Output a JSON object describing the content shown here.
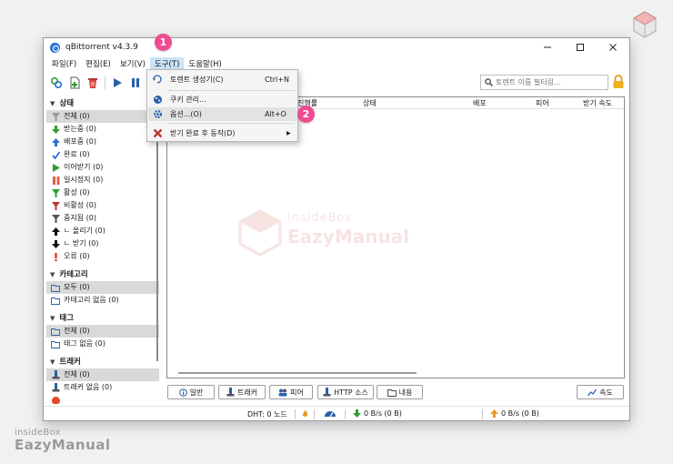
{
  "window": {
    "title": "qBittorrent v4.3.9"
  },
  "menubar": [
    "파일(F)",
    "편집(E)",
    "보기(V)",
    "도구(T)",
    "도움말(H)"
  ],
  "toolbar": {
    "search_placeholder": "토렌트 이름 필터링..."
  },
  "dropdown": {
    "items": [
      {
        "label": "토렌트 생성기(C)",
        "shortcut": "Ctrl+N",
        "icon": "torrent-creator-icon"
      },
      {
        "label": "쿠키 관리...",
        "shortcut": "",
        "icon": "cookie-icon"
      },
      {
        "label": "옵션...(O)",
        "shortcut": "Alt+O",
        "icon": "options-gear-icon"
      },
      {
        "label": "받기 완료 후 동작(D)",
        "shortcut": "",
        "icon": "close-x-icon"
      }
    ]
  },
  "badges": {
    "first": "1",
    "second": "2"
  },
  "sidebar": {
    "status": {
      "header": "상태",
      "items": [
        {
          "label": "전체 (0)",
          "icon": "filter-icon",
          "color": "#999999"
        },
        {
          "label": "받는중 (0)",
          "icon": "arrow-down-icon",
          "color": "#2e9e2e"
        },
        {
          "label": "배포중 (0)",
          "icon": "arrow-up-icon",
          "color": "#2a6fd6"
        },
        {
          "label": "완료 (0)",
          "icon": "check-icon",
          "color": "#2a6fd6"
        },
        {
          "label": "이어받기 (0)",
          "icon": "play-icon",
          "color": "#2e9e2e"
        },
        {
          "label": "일시정지 (0)",
          "icon": "pause-icon",
          "color": "#e0604a"
        },
        {
          "label": "활성 (0)",
          "icon": "filter-icon",
          "color": "#2e9e2e"
        },
        {
          "label": "비활성 (0)",
          "icon": "filter-icon",
          "color": "#c0392b"
        },
        {
          "label": "중지됨 (0)",
          "icon": "filter-icon",
          "color": "#555555"
        },
        {
          "label": "ㄴ 올리기 (0)",
          "icon": "arrow-up-icon",
          "color": "#111111"
        },
        {
          "label": "ㄴ 받기 (0)",
          "icon": "arrow-down-icon",
          "color": "#111111"
        },
        {
          "label": "오류 (0)",
          "icon": "exclamation-icon",
          "color": "#e01010"
        }
      ]
    },
    "categories": {
      "header": "카테고리",
      "items": [
        "모두 (0)",
        "카테고리 없음 (0)"
      ]
    },
    "tags": {
      "header": "태그",
      "items": [
        "전체 (0)",
        "태그 없음 (0)"
      ]
    },
    "trackers": {
      "header": "트래커",
      "items": [
        "전체 (0)",
        "트래커 없음 (0)"
      ]
    }
  },
  "columns": [
    "진행률",
    "상태",
    "배포",
    "피어",
    "받기 속도"
  ],
  "tabs": [
    "일반",
    "트래커",
    "피어",
    "HTTP 소스",
    "내용",
    "속도"
  ],
  "status_bar": {
    "dht": "DHT: 0 노드",
    "download": "0 B/s (0 B)",
    "upload": "0 B/s (0 B)"
  },
  "watermark": {
    "line1": "insideBox",
    "line2": "EazyManual"
  },
  "brand": {
    "line1": "insideBox",
    "line2": "EazyManual"
  }
}
